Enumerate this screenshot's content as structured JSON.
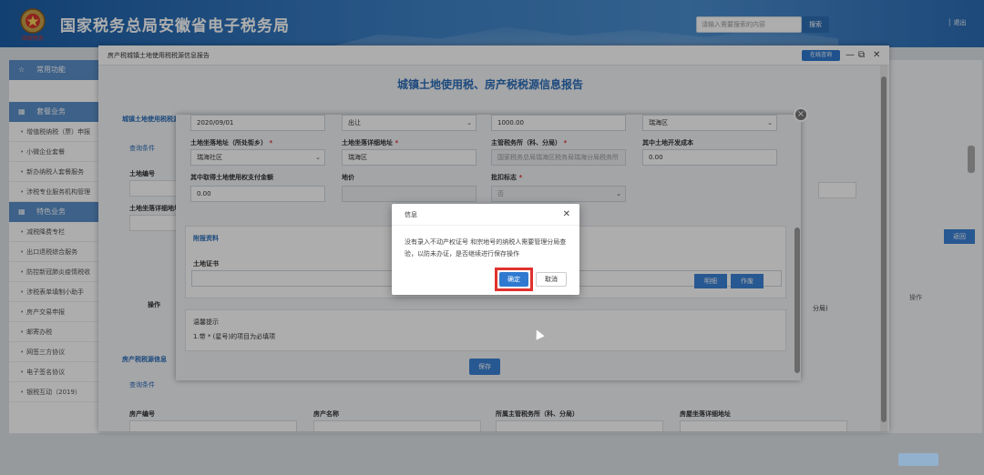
{
  "header": {
    "emblem_text": "国家税务",
    "site_title": "国家税务总局安徽省电子税务局",
    "search_placeholder": "请输入需要搜索的内容",
    "search_button": "搜索",
    "logout": "退出"
  },
  "sidebar": {
    "common_functions": "常用功能",
    "key_business": "套餐业务",
    "key_items": [
      "增值税纳税（票）申报",
      "小微企业套餐",
      "新办纳税人套餐服务",
      "涉税专业服务机构管理"
    ],
    "special_business": "特色业务",
    "special_items": [
      "减税降费专栏",
      "出口退税综合服务",
      "防控新冠肺炎疫情税收",
      "涉税表单填制小助手",
      "房产交易申报",
      "邮寄办税",
      "网签三方协议",
      "电子签名协议",
      "银税互动（2019）"
    ]
  },
  "background": {
    "right_button": "返回",
    "right_op_label": "操作",
    "section_land_info": "城镇土地使用税税源",
    "query_conditions": "查询条件",
    "land_number": "土地编号",
    "land_address": "土地坐落详细地址",
    "operation": "操作",
    "section_house_info": "房产税税源信息",
    "query_conditions2": "查询条件",
    "house_number": "房产编号",
    "house_name": "房产名称",
    "house_tax_office": "所属主管税务所（科、分局）",
    "house_address": "房屋坐落详细地址",
    "attach_btns": [
      "明细",
      "作废"
    ],
    "tax_office_suffix": "分局)"
  },
  "window": {
    "title": "房产税城镇土地使用税税源信息报告",
    "consult_button": "在线咨询",
    "form_title": "城镇土地使用税、房产税税源信息报告"
  },
  "form": {
    "acquire_date": "2020/09/01",
    "acquire_method": "出让",
    "land_area": "1000.00",
    "district_select": "瑞海区",
    "street_label": "土地坐落地址（所处街乡）",
    "street_value": "瑞海社区",
    "detail_address_label": "土地坐落详细地址",
    "detail_address_value": "瑞海区",
    "tax_office_label": "主管税务所（科、分局）",
    "tax_office_value": "国家税务总局瑞海区税务局瑞海分局税务所",
    "dev_cost_label": "其中土地开发成本",
    "dev_cost_value": "0.00",
    "land_fee_label": "其中取得土地使用权支付金额",
    "land_fee_value": "0.00",
    "land_price_label": "地价",
    "land_price_value": "",
    "approved_label": "批扣标志",
    "approved_value": "否",
    "attach_section": "附报资料",
    "land_cert_label": "土地证书",
    "tips_title": "温馨提示",
    "tips_text": "1.带 * (星号)的项目为必填项",
    "save_button": "保存"
  },
  "dialog": {
    "title": "信息",
    "message": "没有录入不动产权证号 和宗地号的纳税人需要管理分局查验，以防未办证，是否继续进行保存操作",
    "confirm": "确定",
    "cancel": "取消"
  }
}
